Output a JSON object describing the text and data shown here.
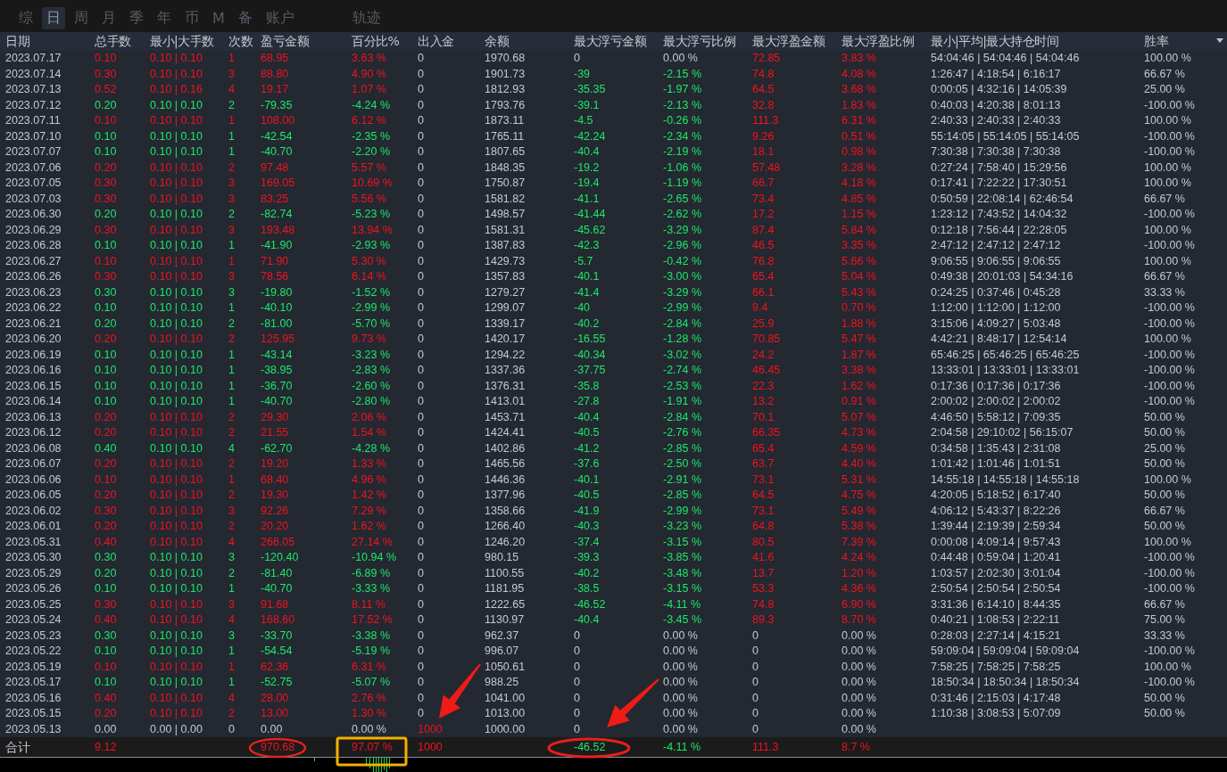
{
  "tabs": [
    {
      "label": "综",
      "selected": false
    },
    {
      "label": "日",
      "selected": true
    },
    {
      "label": "周",
      "selected": false
    },
    {
      "label": "月",
      "selected": false
    },
    {
      "label": "季",
      "selected": false
    },
    {
      "label": "年",
      "selected": false
    },
    {
      "label": "币",
      "selected": false
    },
    {
      "label": "M",
      "selected": false
    },
    {
      "label": "备",
      "selected": false
    },
    {
      "label": "账户",
      "selected": false
    }
  ],
  "tabs_right": [
    {
      "label": "轨迹",
      "selected": false
    }
  ],
  "table": {
    "columns": [
      "日期",
      "总手数",
      "最小|大手数",
      "次数",
      "盈亏金额",
      "百分比%",
      "出入金",
      "余额",
      "最大浮亏金额",
      "最大浮亏比例",
      "最大浮盈金额",
      "最大浮盈比例",
      "最小|平均|最大持仓时间",
      "胜率"
    ],
    "rows": [
      {
        "kind": "win",
        "float_loss": false,
        "float_profit": true,
        "deposit_flag": false,
        "date": "2023.07.17",
        "lots": "0.10",
        "lot_range": "0.10 | 0.10",
        "trades": "1",
        "profit": "68.95",
        "profit_pct": "3.63 %",
        "deposit": "0",
        "balance": "1970.68",
        "max_float_loss": "0",
        "max_float_loss_pct": "0.00 %",
        "max_float_profit": "72.85",
        "max_float_profit_pct": "3.83 %",
        "hold_times": "54:04:46 | 54:04:46 | 54:04:46",
        "win_rate": "100.00 %"
      },
      {
        "kind": "win",
        "float_loss": true,
        "float_profit": true,
        "deposit_flag": false,
        "date": "2023.07.14",
        "lots": "0.30",
        "lot_range": "0.10 | 0.10",
        "trades": "3",
        "profit": "88.80",
        "profit_pct": "4.90 %",
        "deposit": "0",
        "balance": "1901.73",
        "max_float_loss": "-39",
        "max_float_loss_pct": "-2.15 %",
        "max_float_profit": "74.8",
        "max_float_profit_pct": "4.08 %",
        "hold_times": "1:26:47 | 4:18:54 | 6:16:17",
        "win_rate": "66.67 %"
      },
      {
        "kind": "win",
        "float_loss": true,
        "float_profit": true,
        "deposit_flag": false,
        "date": "2023.07.13",
        "lots": "0.52",
        "lot_range": "0.10 | 0.16",
        "trades": "4",
        "profit": "19.17",
        "profit_pct": "1.07 %",
        "deposit": "0",
        "balance": "1812.93",
        "max_float_loss": "-35.35",
        "max_float_loss_pct": "-1.97 %",
        "max_float_profit": "64.5",
        "max_float_profit_pct": "3.68 %",
        "hold_times": "0:00:05 | 4:32:16 | 14:05:39",
        "win_rate": "25.00 %"
      },
      {
        "kind": "loss",
        "float_loss": true,
        "float_profit": true,
        "deposit_flag": false,
        "date": "2023.07.12",
        "lots": "0.20",
        "lot_range": "0.10 | 0.10",
        "trades": "2",
        "profit": "-79.35",
        "profit_pct": "-4.24 %",
        "deposit": "0",
        "balance": "1793.76",
        "max_float_loss": "-39.1",
        "max_float_loss_pct": "-2.13 %",
        "max_float_profit": "32.8",
        "max_float_profit_pct": "1.83 %",
        "hold_times": "0:40:03 | 4:20:38 | 8:01:13",
        "win_rate": "-100.00 %"
      },
      {
        "kind": "win",
        "float_loss": true,
        "float_profit": true,
        "deposit_flag": false,
        "date": "2023.07.11",
        "lots": "0.10",
        "lot_range": "0.10 | 0.10",
        "trades": "1",
        "profit": "108.00",
        "profit_pct": "6.12 %",
        "deposit": "0",
        "balance": "1873.11",
        "max_float_loss": "-4.5",
        "max_float_loss_pct": "-0.26 %",
        "max_float_profit": "111.3",
        "max_float_profit_pct": "6.31 %",
        "hold_times": "2:40:33 | 2:40:33 | 2:40:33",
        "win_rate": "100.00 %"
      },
      {
        "kind": "loss",
        "float_loss": true,
        "float_profit": true,
        "deposit_flag": false,
        "date": "2023.07.10",
        "lots": "0.10",
        "lot_range": "0.10 | 0.10",
        "trades": "1",
        "profit": "-42.54",
        "profit_pct": "-2.35 %",
        "deposit": "0",
        "balance": "1765.11",
        "max_float_loss": "-42.24",
        "max_float_loss_pct": "-2.34 %",
        "max_float_profit": "9.26",
        "max_float_profit_pct": "0.51 %",
        "hold_times": "55:14:05 | 55:14:05 | 55:14:05",
        "win_rate": "-100.00 %"
      },
      {
        "kind": "loss",
        "float_loss": true,
        "float_profit": true,
        "deposit_flag": false,
        "date": "2023.07.07",
        "lots": "0.10",
        "lot_range": "0.10 | 0.10",
        "trades": "1",
        "profit": "-40.70",
        "profit_pct": "-2.20 %",
        "deposit": "0",
        "balance": "1807.65",
        "max_float_loss": "-40.4",
        "max_float_loss_pct": "-2.19 %",
        "max_float_profit": "18.1",
        "max_float_profit_pct": "0.98 %",
        "hold_times": "7:30:38 | 7:30:38 | 7:30:38",
        "win_rate": "-100.00 %"
      },
      {
        "kind": "win",
        "float_loss": true,
        "float_profit": true,
        "deposit_flag": false,
        "date": "2023.07.06",
        "lots": "0.20",
        "lot_range": "0.10 | 0.10",
        "trades": "2",
        "profit": "97.48",
        "profit_pct": "5.57 %",
        "deposit": "0",
        "balance": "1848.35",
        "max_float_loss": "-19.2",
        "max_float_loss_pct": "-1.06 %",
        "max_float_profit": "57.48",
        "max_float_profit_pct": "3.28 %",
        "hold_times": "0:27:24 | 7:58:40 | 15:29:56",
        "win_rate": "100.00 %"
      },
      {
        "kind": "win",
        "float_loss": true,
        "float_profit": true,
        "deposit_flag": false,
        "date": "2023.07.05",
        "lots": "0.30",
        "lot_range": "0.10 | 0.10",
        "trades": "3",
        "profit": "169.05",
        "profit_pct": "10.69 %",
        "deposit": "0",
        "balance": "1750.87",
        "max_float_loss": "-19.4",
        "max_float_loss_pct": "-1.19 %",
        "max_float_profit": "66.7",
        "max_float_profit_pct": "4.18 %",
        "hold_times": "0:17:41 | 7:22:22 | 17:30:51",
        "win_rate": "100.00 %"
      },
      {
        "kind": "win",
        "float_loss": true,
        "float_profit": true,
        "deposit_flag": false,
        "date": "2023.07.03",
        "lots": "0.30",
        "lot_range": "0.10 | 0.10",
        "trades": "3",
        "profit": "83.25",
        "profit_pct": "5.56 %",
        "deposit": "0",
        "balance": "1581.82",
        "max_float_loss": "-41.1",
        "max_float_loss_pct": "-2.65 %",
        "max_float_profit": "73.4",
        "max_float_profit_pct": "4.85 %",
        "hold_times": "0:50:59 | 22:08:14 | 62:46:54",
        "win_rate": "66.67 %"
      },
      {
        "kind": "loss",
        "float_loss": true,
        "float_profit": true,
        "deposit_flag": false,
        "date": "2023.06.30",
        "lots": "0.20",
        "lot_range": "0.10 | 0.10",
        "trades": "2",
        "profit": "-82.74",
        "profit_pct": "-5.23 %",
        "deposit": "0",
        "balance": "1498.57",
        "max_float_loss": "-41.44",
        "max_float_loss_pct": "-2.62 %",
        "max_float_profit": "17.2",
        "max_float_profit_pct": "1.15 %",
        "hold_times": "1:23:12 | 7:43:52 | 14:04:32",
        "win_rate": "-100.00 %"
      },
      {
        "kind": "win",
        "float_loss": true,
        "float_profit": true,
        "deposit_flag": false,
        "date": "2023.06.29",
        "lots": "0.30",
        "lot_range": "0.10 | 0.10",
        "trades": "3",
        "profit": "193.48",
        "profit_pct": "13.94 %",
        "deposit": "0",
        "balance": "1581.31",
        "max_float_loss": "-45.62",
        "max_float_loss_pct": "-3.29 %",
        "max_float_profit": "87.4",
        "max_float_profit_pct": "5.84 %",
        "hold_times": "0:12:18 | 7:56:44 | 22:28:05",
        "win_rate": "100.00 %"
      },
      {
        "kind": "loss",
        "float_loss": true,
        "float_profit": true,
        "deposit_flag": false,
        "date": "2023.06.28",
        "lots": "0.10",
        "lot_range": "0.10 | 0.10",
        "trades": "1",
        "profit": "-41.90",
        "profit_pct": "-2.93 %",
        "deposit": "0",
        "balance": "1387.83",
        "max_float_loss": "-42.3",
        "max_float_loss_pct": "-2.96 %",
        "max_float_profit": "46.5",
        "max_float_profit_pct": "3.35 %",
        "hold_times": "2:47:12 | 2:47:12 | 2:47:12",
        "win_rate": "-100.00 %"
      },
      {
        "kind": "win",
        "float_loss": true,
        "float_profit": true,
        "deposit_flag": false,
        "date": "2023.06.27",
        "lots": "0.10",
        "lot_range": "0.10 | 0.10",
        "trades": "1",
        "profit": "71.90",
        "profit_pct": "5.30 %",
        "deposit": "0",
        "balance": "1429.73",
        "max_float_loss": "-5.7",
        "max_float_loss_pct": "-0.42 %",
        "max_float_profit": "76.8",
        "max_float_profit_pct": "5.66 %",
        "hold_times": "9:06:55 | 9:06:55 | 9:06:55",
        "win_rate": "100.00 %"
      },
      {
        "kind": "win",
        "float_loss": true,
        "float_profit": true,
        "deposit_flag": false,
        "date": "2023.06.26",
        "lots": "0.30",
        "lot_range": "0.10 | 0.10",
        "trades": "3",
        "profit": "78.56",
        "profit_pct": "6.14 %",
        "deposit": "0",
        "balance": "1357.83",
        "max_float_loss": "-40.1",
        "max_float_loss_pct": "-3.00 %",
        "max_float_profit": "65.4",
        "max_float_profit_pct": "5.04 %",
        "hold_times": "0:49:38 | 20:01:03 | 54:34:16",
        "win_rate": "66.67 %"
      },
      {
        "kind": "loss",
        "float_loss": true,
        "float_profit": true,
        "deposit_flag": false,
        "date": "2023.06.23",
        "lots": "0.30",
        "lot_range": "0.10 | 0.10",
        "trades": "3",
        "profit": "-19.80",
        "profit_pct": "-1.52 %",
        "deposit": "0",
        "balance": "1279.27",
        "max_float_loss": "-41.4",
        "max_float_loss_pct": "-3.29 %",
        "max_float_profit": "66.1",
        "max_float_profit_pct": "5.43 %",
        "hold_times": "0:24:25 | 0:37:46 | 0:45:28",
        "win_rate": "33.33 %"
      },
      {
        "kind": "loss",
        "float_loss": true,
        "float_profit": true,
        "deposit_flag": false,
        "date": "2023.06.22",
        "lots": "0.10",
        "lot_range": "0.10 | 0.10",
        "trades": "1",
        "profit": "-40.10",
        "profit_pct": "-2.99 %",
        "deposit": "0",
        "balance": "1299.07",
        "max_float_loss": "-40",
        "max_float_loss_pct": "-2.99 %",
        "max_float_profit": "9.4",
        "max_float_profit_pct": "0.70 %",
        "hold_times": "1:12:00 | 1:12:00 | 1:12:00",
        "win_rate": "-100.00 %"
      },
      {
        "kind": "loss",
        "float_loss": true,
        "float_profit": true,
        "deposit_flag": false,
        "date": "2023.06.21",
        "lots": "0.20",
        "lot_range": "0.10 | 0.10",
        "trades": "2",
        "profit": "-81.00",
        "profit_pct": "-5.70 %",
        "deposit": "0",
        "balance": "1339.17",
        "max_float_loss": "-40.2",
        "max_float_loss_pct": "-2.84 %",
        "max_float_profit": "25.9",
        "max_float_profit_pct": "1.88 %",
        "hold_times": "3:15:06 | 4:09:27 | 5:03:48",
        "win_rate": "-100.00 %"
      },
      {
        "kind": "win",
        "float_loss": true,
        "float_profit": true,
        "deposit_flag": false,
        "date": "2023.06.20",
        "lots": "0.20",
        "lot_range": "0.10 | 0.10",
        "trades": "2",
        "profit": "125.95",
        "profit_pct": "9.73 %",
        "deposit": "0",
        "balance": "1420.17",
        "max_float_loss": "-16.55",
        "max_float_loss_pct": "-1.28 %",
        "max_float_profit": "70.85",
        "max_float_profit_pct": "5.47 %",
        "hold_times": "4:42:21 | 8:48:17 | 12:54:14",
        "win_rate": "100.00 %"
      },
      {
        "kind": "loss",
        "float_loss": true,
        "float_profit": true,
        "deposit_flag": false,
        "date": "2023.06.19",
        "lots": "0.10",
        "lot_range": "0.10 | 0.10",
        "trades": "1",
        "profit": "-43.14",
        "profit_pct": "-3.23 %",
        "deposit": "0",
        "balance": "1294.22",
        "max_float_loss": "-40.34",
        "max_float_loss_pct": "-3.02 %",
        "max_float_profit": "24.2",
        "max_float_profit_pct": "1.87 %",
        "hold_times": "65:46:25 | 65:46:25 | 65:46:25",
        "win_rate": "-100.00 %"
      },
      {
        "kind": "loss",
        "float_loss": true,
        "float_profit": true,
        "deposit_flag": false,
        "date": "2023.06.16",
        "lots": "0.10",
        "lot_range": "0.10 | 0.10",
        "trades": "1",
        "profit": "-38.95",
        "profit_pct": "-2.83 %",
        "deposit": "0",
        "balance": "1337.36",
        "max_float_loss": "-37.75",
        "max_float_loss_pct": "-2.74 %",
        "max_float_profit": "46.45",
        "max_float_profit_pct": "3.38 %",
        "hold_times": "13:33:01 | 13:33:01 | 13:33:01",
        "win_rate": "-100.00 %"
      },
      {
        "kind": "loss",
        "float_loss": true,
        "float_profit": true,
        "deposit_flag": false,
        "date": "2023.06.15",
        "lots": "0.10",
        "lot_range": "0.10 | 0.10",
        "trades": "1",
        "profit": "-36.70",
        "profit_pct": "-2.60 %",
        "deposit": "0",
        "balance": "1376.31",
        "max_float_loss": "-35.8",
        "max_float_loss_pct": "-2.53 %",
        "max_float_profit": "22.3",
        "max_float_profit_pct": "1.62 %",
        "hold_times": "0:17:36 | 0:17:36 | 0:17:36",
        "win_rate": "-100.00 %"
      },
      {
        "kind": "loss",
        "float_loss": true,
        "float_profit": true,
        "deposit_flag": false,
        "date": "2023.06.14",
        "lots": "0.10",
        "lot_range": "0.10 | 0.10",
        "trades": "1",
        "profit": "-40.70",
        "profit_pct": "-2.80 %",
        "deposit": "0",
        "balance": "1413.01",
        "max_float_loss": "-27.8",
        "max_float_loss_pct": "-1.91 %",
        "max_float_profit": "13.2",
        "max_float_profit_pct": "0.91 %",
        "hold_times": "2:00:02 | 2:00:02 | 2:00:02",
        "win_rate": "-100.00 %"
      },
      {
        "kind": "win",
        "float_loss": true,
        "float_profit": true,
        "deposit_flag": false,
        "date": "2023.06.13",
        "lots": "0.20",
        "lot_range": "0.10 | 0.10",
        "trades": "2",
        "profit": "29.30",
        "profit_pct": "2.06 %",
        "deposit": "0",
        "balance": "1453.71",
        "max_float_loss": "-40.4",
        "max_float_loss_pct": "-2.84 %",
        "max_float_profit": "70.1",
        "max_float_profit_pct": "5.07 %",
        "hold_times": "4:46:50 | 5:58:12 | 7:09:35",
        "win_rate": "50.00 %"
      },
      {
        "kind": "win",
        "float_loss": true,
        "float_profit": true,
        "deposit_flag": false,
        "date": "2023.06.12",
        "lots": "0.20",
        "lot_range": "0.10 | 0.10",
        "trades": "2",
        "profit": "21.55",
        "profit_pct": "1.54 %",
        "deposit": "0",
        "balance": "1424.41",
        "max_float_loss": "-40.5",
        "max_float_loss_pct": "-2.76 %",
        "max_float_profit": "66.35",
        "max_float_profit_pct": "4.73 %",
        "hold_times": "2:04:58 | 29:10:02 | 56:15:07",
        "win_rate": "50.00 %"
      },
      {
        "kind": "loss",
        "float_loss": true,
        "float_profit": true,
        "deposit_flag": false,
        "date": "2023.06.08",
        "lots": "0.40",
        "lot_range": "0.10 | 0.10",
        "trades": "4",
        "profit": "-62.70",
        "profit_pct": "-4.28 %",
        "deposit": "0",
        "balance": "1402.86",
        "max_float_loss": "-41.2",
        "max_float_loss_pct": "-2.85 %",
        "max_float_profit": "65.4",
        "max_float_profit_pct": "4.59 %",
        "hold_times": "0:34:58 | 1:35:43 | 2:31:08",
        "win_rate": "25.00 %"
      },
      {
        "kind": "win",
        "float_loss": true,
        "float_profit": true,
        "deposit_flag": false,
        "date": "2023.06.07",
        "lots": "0.20",
        "lot_range": "0.10 | 0.10",
        "trades": "2",
        "profit": "19.20",
        "profit_pct": "1.33 %",
        "deposit": "0",
        "balance": "1465.56",
        "max_float_loss": "-37.6",
        "max_float_loss_pct": "-2.50 %",
        "max_float_profit": "63.7",
        "max_float_profit_pct": "4.40 %",
        "hold_times": "1:01:42 | 1:01:46 | 1:01:51",
        "win_rate": "50.00 %"
      },
      {
        "kind": "win",
        "float_loss": true,
        "float_profit": true,
        "deposit_flag": false,
        "date": "2023.06.06",
        "lots": "0.10",
        "lot_range": "0.10 | 0.10",
        "trades": "1",
        "profit": "68.40",
        "profit_pct": "4.96 %",
        "deposit": "0",
        "balance": "1446.36",
        "max_float_loss": "-40.1",
        "max_float_loss_pct": "-2.91 %",
        "max_float_profit": "73.1",
        "max_float_profit_pct": "5.31 %",
        "hold_times": "14:55:18 | 14:55:18 | 14:55:18",
        "win_rate": "100.00 %"
      },
      {
        "kind": "win",
        "float_loss": true,
        "float_profit": true,
        "deposit_flag": false,
        "date": "2023.06.05",
        "lots": "0.20",
        "lot_range": "0.10 | 0.10",
        "trades": "2",
        "profit": "19.30",
        "profit_pct": "1.42 %",
        "deposit": "0",
        "balance": "1377.96",
        "max_float_loss": "-40.5",
        "max_float_loss_pct": "-2.85 %",
        "max_float_profit": "64.5",
        "max_float_profit_pct": "4.75 %",
        "hold_times": "4:20:05 | 5:18:52 | 6:17:40",
        "win_rate": "50.00 %"
      },
      {
        "kind": "win",
        "float_loss": true,
        "float_profit": true,
        "deposit_flag": false,
        "date": "2023.06.02",
        "lots": "0.30",
        "lot_range": "0.10 | 0.10",
        "trades": "3",
        "profit": "92.26",
        "profit_pct": "7.29 %",
        "deposit": "0",
        "balance": "1358.66",
        "max_float_loss": "-41.9",
        "max_float_loss_pct": "-2.99 %",
        "max_float_profit": "73.1",
        "max_float_profit_pct": "5.49 %",
        "hold_times": "4:06:12 | 5:43:37 | 8:22:26",
        "win_rate": "66.67 %"
      },
      {
        "kind": "win",
        "float_loss": true,
        "float_profit": true,
        "deposit_flag": false,
        "date": "2023.06.01",
        "lots": "0.20",
        "lot_range": "0.10 | 0.10",
        "trades": "2",
        "profit": "20.20",
        "profit_pct": "1.62 %",
        "deposit": "0",
        "balance": "1266.40",
        "max_float_loss": "-40.3",
        "max_float_loss_pct": "-3.23 %",
        "max_float_profit": "64.8",
        "max_float_profit_pct": "5.38 %",
        "hold_times": "1:39:44 | 2:19:39 | 2:59:34",
        "win_rate": "50.00 %"
      },
      {
        "kind": "win",
        "float_loss": true,
        "float_profit": true,
        "deposit_flag": false,
        "date": "2023.05.31",
        "lots": "0.40",
        "lot_range": "0.10 | 0.10",
        "trades": "4",
        "profit": "266.05",
        "profit_pct": "27.14 %",
        "deposit": "0",
        "balance": "1246.20",
        "max_float_loss": "-37.4",
        "max_float_loss_pct": "-3.15 %",
        "max_float_profit": "80.5",
        "max_float_profit_pct": "7.39 %",
        "hold_times": "0:00:08 | 4:09:14 | 9:57:43",
        "win_rate": "100.00 %"
      },
      {
        "kind": "loss",
        "float_loss": true,
        "float_profit": true,
        "deposit_flag": false,
        "date": "2023.05.30",
        "lots": "0.30",
        "lot_range": "0.10 | 0.10",
        "trades": "3",
        "profit": "-120.40",
        "profit_pct": "-10.94 %",
        "deposit": "0",
        "balance": "980.15",
        "max_float_loss": "-39.3",
        "max_float_loss_pct": "-3.85 %",
        "max_float_profit": "41.6",
        "max_float_profit_pct": "4.24 %",
        "hold_times": "0:44:48 | 0:59:04 | 1:20:41",
        "win_rate": "-100.00 %"
      },
      {
        "kind": "loss",
        "float_loss": true,
        "float_profit": true,
        "deposit_flag": false,
        "date": "2023.05.29",
        "lots": "0.20",
        "lot_range": "0.10 | 0.10",
        "trades": "2",
        "profit": "-81.40",
        "profit_pct": "-6.89 %",
        "deposit": "0",
        "balance": "1100.55",
        "max_float_loss": "-40.2",
        "max_float_loss_pct": "-3.48 %",
        "max_float_profit": "13.7",
        "max_float_profit_pct": "1.20 %",
        "hold_times": "1:03:57 | 2:02:30 | 3:01:04",
        "win_rate": "-100.00 %"
      },
      {
        "kind": "loss",
        "float_loss": true,
        "float_profit": true,
        "deposit_flag": false,
        "date": "2023.05.26",
        "lots": "0.10",
        "lot_range": "0.10 | 0.10",
        "trades": "1",
        "profit": "-40.70",
        "profit_pct": "-3.33 %",
        "deposit": "0",
        "balance": "1181.95",
        "max_float_loss": "-38.5",
        "max_float_loss_pct": "-3.15 %",
        "max_float_profit": "53.3",
        "max_float_profit_pct": "4.36 %",
        "hold_times": "2:50:54 | 2:50:54 | 2:50:54",
        "win_rate": "-100.00 %"
      },
      {
        "kind": "win",
        "float_loss": true,
        "float_profit": true,
        "deposit_flag": false,
        "date": "2023.05.25",
        "lots": "0.30",
        "lot_range": "0.10 | 0.10",
        "trades": "3",
        "profit": "91.68",
        "profit_pct": "8.11 %",
        "deposit": "0",
        "balance": "1222.65",
        "max_float_loss": "-46.52",
        "max_float_loss_pct": "-4.11 %",
        "max_float_profit": "74.8",
        "max_float_profit_pct": "6.90 %",
        "hold_times": "3:31:36 | 6:14:10 | 8:44:35",
        "win_rate": "66.67 %"
      },
      {
        "kind": "win",
        "float_loss": true,
        "float_profit": true,
        "deposit_flag": false,
        "date": "2023.05.24",
        "lots": "0.40",
        "lot_range": "0.10 | 0.10",
        "trades": "4",
        "profit": "168.60",
        "profit_pct": "17.52 %",
        "deposit": "0",
        "balance": "1130.97",
        "max_float_loss": "-40.4",
        "max_float_loss_pct": "-3.45 %",
        "max_float_profit": "89.3",
        "max_float_profit_pct": "8.70 %",
        "hold_times": "0:40:21 | 1:08:53 | 2:22:11",
        "win_rate": "75.00 %"
      },
      {
        "kind": "loss",
        "float_loss": false,
        "float_profit": false,
        "deposit_flag": false,
        "date": "2023.05.23",
        "lots": "0.30",
        "lot_range": "0.10 | 0.10",
        "trades": "3",
        "profit": "-33.70",
        "profit_pct": "-3.38 %",
        "deposit": "0",
        "balance": "962.37",
        "max_float_loss": "0",
        "max_float_loss_pct": "0.00 %",
        "max_float_profit": "0",
        "max_float_profit_pct": "0.00 %",
        "hold_times": "0:28:03 | 2:27:14 | 4:15:21",
        "win_rate": "33.33 %"
      },
      {
        "kind": "loss",
        "float_loss": false,
        "float_profit": false,
        "deposit_flag": false,
        "date": "2023.05.22",
        "lots": "0.10",
        "lot_range": "0.10 | 0.10",
        "trades": "1",
        "profit": "-54.54",
        "profit_pct": "-5.19 %",
        "deposit": "0",
        "balance": "996.07",
        "max_float_loss": "0",
        "max_float_loss_pct": "0.00 %",
        "max_float_profit": "0",
        "max_float_profit_pct": "0.00 %",
        "hold_times": "59:09:04 | 59:09:04 | 59:09:04",
        "win_rate": "-100.00 %"
      },
      {
        "kind": "win",
        "float_loss": false,
        "float_profit": false,
        "deposit_flag": false,
        "date": "2023.05.19",
        "lots": "0.10",
        "lot_range": "0.10 | 0.10",
        "trades": "1",
        "profit": "62.36",
        "profit_pct": "6.31 %",
        "deposit": "0",
        "balance": "1050.61",
        "max_float_loss": "0",
        "max_float_loss_pct": "0.00 %",
        "max_float_profit": "0",
        "max_float_profit_pct": "0.00 %",
        "hold_times": "7:58:25 | 7:58:25 | 7:58:25",
        "win_rate": "100.00 %"
      },
      {
        "kind": "loss",
        "float_loss": false,
        "float_profit": false,
        "deposit_flag": false,
        "date": "2023.05.17",
        "lots": "0.10",
        "lot_range": "0.10 | 0.10",
        "trades": "1",
        "profit": "-52.75",
        "profit_pct": "-5.07 %",
        "deposit": "0",
        "balance": "988.25",
        "max_float_loss": "0",
        "max_float_loss_pct": "0.00 %",
        "max_float_profit": "0",
        "max_float_profit_pct": "0.00 %",
        "hold_times": "18:50:34 | 18:50:34 | 18:50:34",
        "win_rate": "-100.00 %"
      },
      {
        "kind": "win",
        "float_loss": false,
        "float_profit": false,
        "deposit_flag": false,
        "date": "2023.05.16",
        "lots": "0.40",
        "lot_range": "0.10 | 0.10",
        "trades": "4",
        "profit": "28.00",
        "profit_pct": "2.76 %",
        "deposit": "0",
        "balance": "1041.00",
        "max_float_loss": "0",
        "max_float_loss_pct": "0.00 %",
        "max_float_profit": "0",
        "max_float_profit_pct": "0.00 %",
        "hold_times": "0:31:46 | 2:15:03 | 4:17:48",
        "win_rate": "50.00 %"
      },
      {
        "kind": "win",
        "float_loss": false,
        "float_profit": false,
        "deposit_flag": false,
        "date": "2023.05.15",
        "lots": "0.20",
        "lot_range": "0.10 | 0.10",
        "trades": "2",
        "profit": "13.00",
        "profit_pct": "1.30 %",
        "deposit": "0",
        "balance": "1013.00",
        "max_float_loss": "0",
        "max_float_loss_pct": "0.00 %",
        "max_float_profit": "0",
        "max_float_profit_pct": "0.00 %",
        "hold_times": "1:10:38 | 3:08:53 | 5:07:09",
        "win_rate": "50.00 %"
      },
      {
        "kind": "flat",
        "float_loss": false,
        "float_profit": false,
        "deposit_flag": true,
        "date": "2023.05.13",
        "lots": "0.00",
        "lot_range": "0.00 | 0.00",
        "trades": "0",
        "profit": "0.00",
        "profit_pct": "0.00 %",
        "deposit": "1000",
        "balance": "1000.00",
        "max_float_loss": "0",
        "max_float_loss_pct": "0.00 %",
        "max_float_profit": "0",
        "max_float_profit_pct": "0.00 %"
      }
    ],
    "total": {
      "kind": "win",
      "float_loss": true,
      "float_profit": true,
      "deposit_flag": true,
      "date": "合计",
      "lots": "9.12",
      "profit": "970.68",
      "profit_pct": "97.07 %",
      "deposit": "1000",
      "max_float_loss": "-46.52",
      "max_float_loss_pct": "-4.11 %",
      "max_float_profit": "111.3",
      "max_float_profit_pct": "8.7 %"
    }
  }
}
